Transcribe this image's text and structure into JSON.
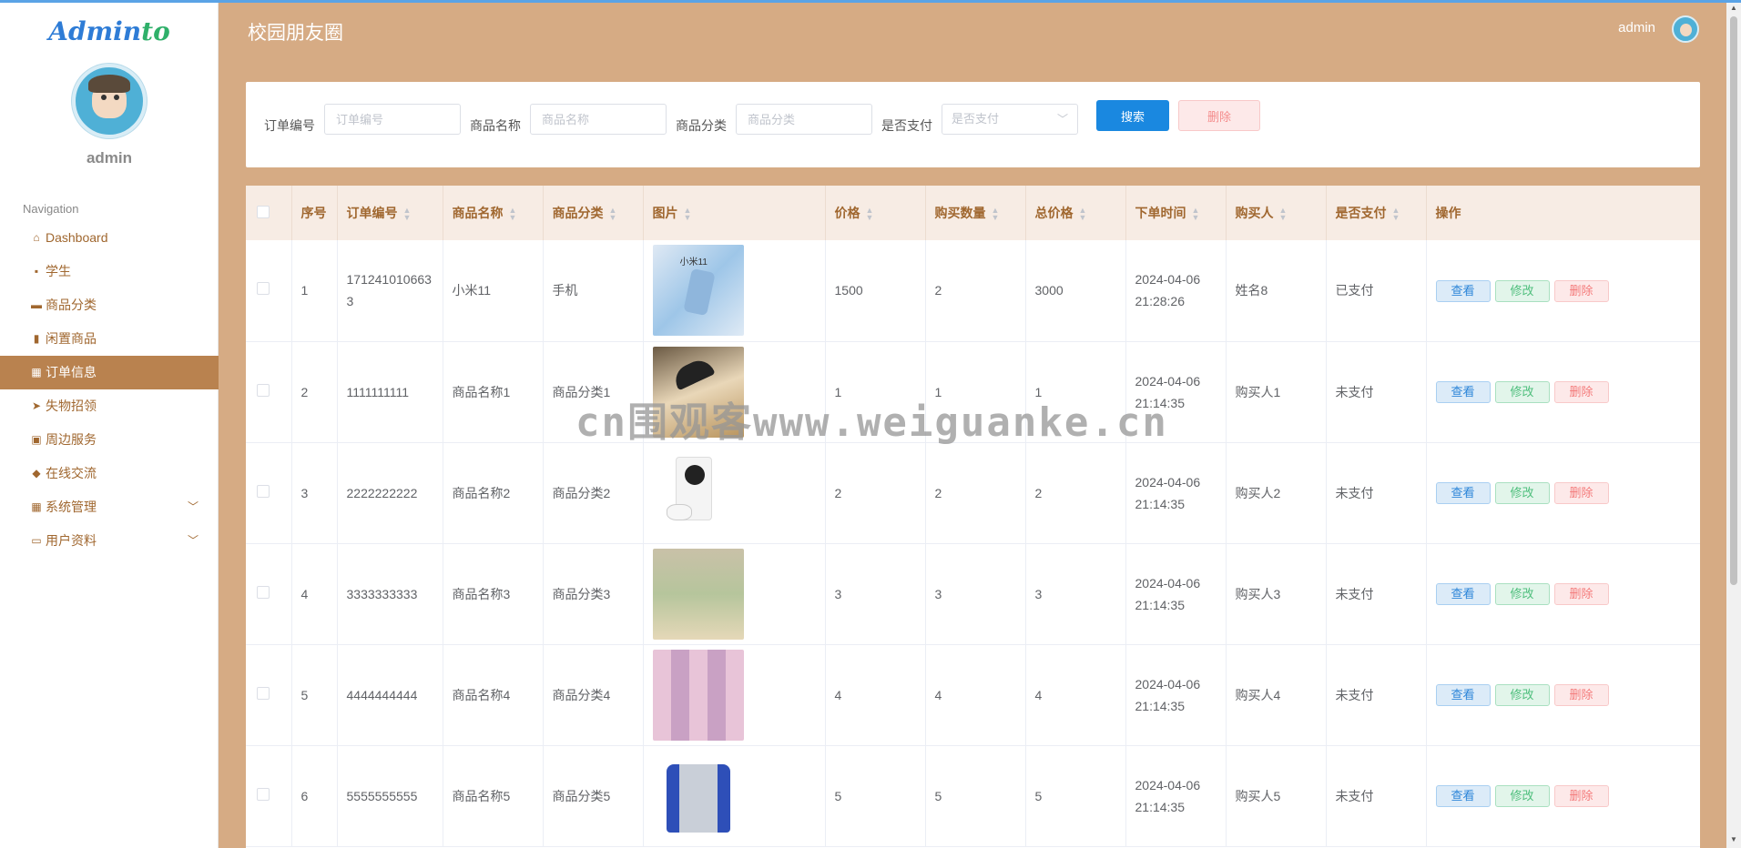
{
  "sidebar": {
    "brand": "Admin",
    "brand_suffix": "to",
    "admin_name": "admin",
    "nav_title": "Navigation",
    "items": [
      {
        "label": "Dashboard",
        "icon": "home-icon"
      },
      {
        "label": "学生",
        "icon": "chat-icon"
      },
      {
        "label": "商品分类",
        "icon": "briefcase-icon"
      },
      {
        "label": "闲置商品",
        "icon": "clipboard-icon"
      },
      {
        "label": "订单信息",
        "icon": "grid-icon",
        "active": true
      },
      {
        "label": "失物招领",
        "icon": "send-icon"
      },
      {
        "label": "周边服务",
        "icon": "clipboard-check-icon"
      },
      {
        "label": "在线交流",
        "icon": "thumb-icon"
      },
      {
        "label": "系统管理",
        "icon": "grid-icon"
      },
      {
        "label": "用户资料",
        "icon": "card-icon"
      }
    ]
  },
  "header": {
    "title": "校园朋友圈",
    "user": "admin"
  },
  "search": {
    "order_no_label": "订单编号",
    "order_no_placeholder": "订单编号",
    "name_label": "商品名称",
    "name_placeholder": "商品名称",
    "category_label": "商品分类",
    "category_placeholder": "商品分类",
    "paid_label": "是否支付",
    "paid_placeholder": "是否支付",
    "search_button": "搜索",
    "delete_button": "删除"
  },
  "table": {
    "columns": [
      "序号",
      "订单编号",
      "商品名称",
      "商品分类",
      "图片",
      "价格",
      "购买数量",
      "总价格",
      "下单时间",
      "购买人",
      "是否支付",
      "操作"
    ],
    "rows": [
      {
        "idx": "1",
        "order_no": "1712410106633",
        "name": "小米11",
        "category": "手机",
        "image": "小米11",
        "price": "1500",
        "qty": "2",
        "total": "3000",
        "time": "2024-04-06 21:28:26",
        "buyer": "姓名8",
        "paid": "已支付"
      },
      {
        "idx": "2",
        "order_no": "1111111111",
        "name": "商品名称1",
        "category": "商品分类1",
        "image": "",
        "price": "1",
        "qty": "1",
        "total": "1",
        "time": "2024-04-06 21:14:35",
        "buyer": "购买人1",
        "paid": "未支付"
      },
      {
        "idx": "3",
        "order_no": "2222222222",
        "name": "商品名称2",
        "category": "商品分类2",
        "image": "",
        "price": "2",
        "qty": "2",
        "total": "2",
        "time": "2024-04-06 21:14:35",
        "buyer": "购买人2",
        "paid": "未支付"
      },
      {
        "idx": "4",
        "order_no": "3333333333",
        "name": "商品名称3",
        "category": "商品分类3",
        "image": "",
        "price": "3",
        "qty": "3",
        "total": "3",
        "time": "2024-04-06 21:14:35",
        "buyer": "购买人3",
        "paid": "未支付"
      },
      {
        "idx": "5",
        "order_no": "4444444444",
        "name": "商品名称4",
        "category": "商品分类4",
        "image": "",
        "price": "4",
        "qty": "4",
        "total": "4",
        "time": "2024-04-06 21:14:35",
        "buyer": "购买人4",
        "paid": "未支付"
      },
      {
        "idx": "6",
        "order_no": "5555555555",
        "name": "商品名称5",
        "category": "商品分类5",
        "image": "",
        "price": "5",
        "qty": "5",
        "total": "5",
        "time": "2024-04-06 21:14:35",
        "buyer": "购买人5",
        "paid": "未支付"
      }
    ],
    "actions": {
      "view": "查看",
      "edit": "修改",
      "delete": "删除"
    }
  },
  "watermark": "cn围观客www.weiguanke.cn",
  "colors": {
    "background": "#d6ab84",
    "sidebar_active": "#b9824f",
    "accent_text": "#a0672f",
    "primary": "#1a88e0"
  }
}
